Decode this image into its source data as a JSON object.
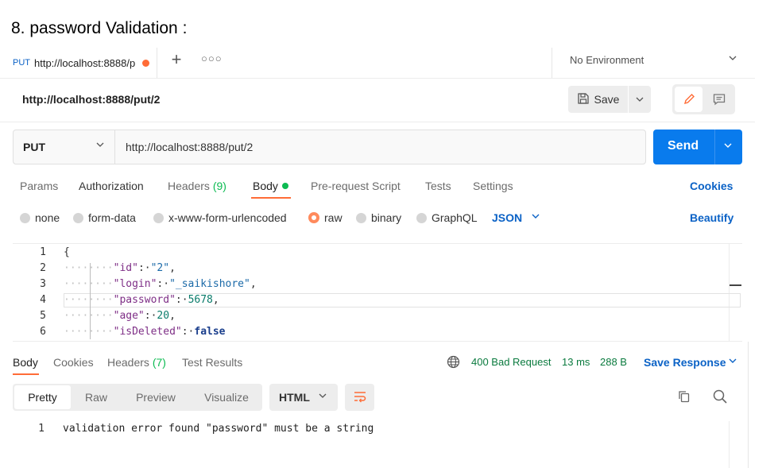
{
  "heading": "8.  password Validation :",
  "tab": {
    "method": "PUT",
    "title": "http://localhost:8888/p",
    "unsaved": true
  },
  "environment": {
    "label": "No Environment"
  },
  "request": {
    "name": "http://localhost:8888/put/2",
    "method": "PUT",
    "url": "http://localhost:8888/put/2",
    "save_label": "Save",
    "send_label": "Send"
  },
  "request_tabs": [
    {
      "label": "Params"
    },
    {
      "label": "Authorization"
    },
    {
      "label": "Headers",
      "count": "(9)"
    },
    {
      "label": "Body",
      "active": true
    },
    {
      "label": "Pre-request Script"
    },
    {
      "label": "Tests"
    },
    {
      "label": "Settings"
    }
  ],
  "cookies_label": "Cookies",
  "body_types": [
    {
      "label": "none"
    },
    {
      "label": "form-data"
    },
    {
      "label": "x-www-form-urlencoded"
    },
    {
      "label": "raw",
      "selected": true
    },
    {
      "label": "binary"
    },
    {
      "label": "GraphQL"
    }
  ],
  "body_format": "JSON",
  "beautify_label": "Beautify",
  "editor": {
    "line_numbers": [
      "1",
      "2",
      "3",
      "4",
      "5",
      "6"
    ],
    "lines": [
      {
        "text": "{"
      },
      {
        "key": "\"id\"",
        "value": "\"2\"",
        "type": "string",
        "trail": ","
      },
      {
        "key": "\"login\"",
        "value": "\"_saikishore\"",
        "type": "string",
        "trail": ","
      },
      {
        "key": "\"password\"",
        "value": "5678",
        "type": "number",
        "trail": ","
      },
      {
        "key": "\"age\"",
        "value": "20",
        "type": "number",
        "trail": ","
      },
      {
        "key": "\"isDeleted\"",
        "value": "false",
        "type": "boolean",
        "trail": ""
      }
    ]
  },
  "response": {
    "tabs": [
      {
        "label": "Body",
        "active": true
      },
      {
        "label": "Cookies"
      },
      {
        "label": "Headers",
        "count": "(7)"
      },
      {
        "label": "Test Results"
      }
    ],
    "status": "400 Bad Request",
    "time": "13 ms",
    "size": "288 B",
    "save_response_label": "Save Response",
    "view_modes": [
      "Pretty",
      "Raw",
      "Preview",
      "Visualize"
    ],
    "format": "HTML",
    "line_number": "1",
    "body": "validation error found \"password\" must be a string"
  },
  "colors": {
    "accent_orange": "#ff6c37",
    "send_blue": "#097bed",
    "link_blue": "#0b62c6",
    "status_green": "#0a7a3e"
  }
}
